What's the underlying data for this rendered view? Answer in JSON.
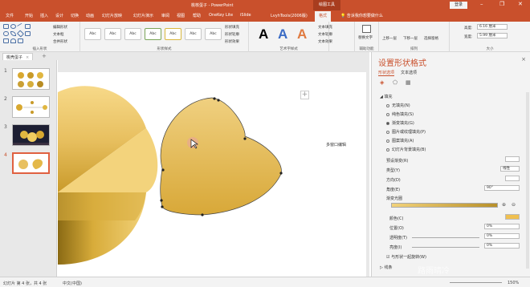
{
  "titlebar": {
    "document": "桃核蛋子 - PowerPoint",
    "context_tab": "绘图工具",
    "login": "登录",
    "minimize": "–",
    "restore": "❐",
    "close": "✕"
  },
  "tabs": [
    "文件",
    "开始",
    "插入",
    "设计",
    "切换",
    "动画",
    "幻灯片放映",
    "幻灯片演示",
    "审阅",
    "视图",
    "帮助",
    "OneKey Lite",
    "iSlide",
    "LvyhTools(2006版)",
    "格式"
  ],
  "tellme": "告诉我你想要做什么",
  "ribbon": {
    "insert_shapes": {
      "label": "插入形状",
      "edit_shape": "编辑形状",
      "text_box": "文本框",
      "merge": "合并形状"
    },
    "shape_styles": {
      "label": "形状样式",
      "style_text": "Abc",
      "fill": "形状填充",
      "outline": "形状轮廓",
      "effects": "形状效果"
    },
    "wordart": {
      "label": "艺术字样式",
      "letter": "A",
      "text_fill": "文本填充",
      "text_outline": "文本轮廓",
      "text_effects": "文本效果"
    },
    "accessibility": {
      "label": "辅助功能",
      "alt_text": "替换文字"
    },
    "arrange": {
      "label": "排列",
      "bring_forward": "上移一层",
      "send_backward": "下移一层",
      "selection_pane": "选择窗格"
    },
    "size": {
      "label": "大小",
      "height_label": "高度:",
      "height": "6.16 厘米",
      "width_label": "宽度:",
      "width": "5.99 厘米"
    }
  },
  "doc_tab": {
    "name": "桃壳蛋子",
    "close": "×",
    "add": "+"
  },
  "slides": [
    {
      "num": "1"
    },
    {
      "num": "2"
    },
    {
      "num": "3"
    },
    {
      "num": "4"
    }
  ],
  "canvas": {
    "multi_window": "多窗口编辑",
    "add_icon": "+"
  },
  "pane": {
    "title": "设置形状格式",
    "close": "×",
    "tab_shape": "形状选项",
    "tab_text": "文本选项",
    "fill_header": "填充",
    "fill_options": [
      "无填充(N)",
      "纯色填充(S)",
      "渐变填充(G)",
      "图片或纹理填充(P)",
      "图案填充(A)",
      "幻灯片背景填充(B)"
    ],
    "selected_fill": 2,
    "preset_label": "预设渐变(R)",
    "type_label": "类型(Y)",
    "type_value": "线性",
    "direction_label": "方向(D)",
    "angle_label": "角度(E)",
    "angle_value": "90°",
    "stops_label": "渐变光圈",
    "color_label": "颜色(C)",
    "position_label": "位置(O)",
    "position_value": "0%",
    "transparency_label": "透明度(T)",
    "transparency_value": "0%",
    "brightness_label": "亮度(I)",
    "brightness_value": "0%",
    "rotate_label": "与形状一起旋转(W)",
    "line_header": "线条"
  },
  "status": {
    "slide_info": "幻灯片 第 4 张，共 4 张",
    "language": "中文(中国)",
    "zoom": "150%"
  },
  "watermark": "路雨晴冷",
  "colors": {
    "accent": "#c9502c",
    "gold": "#e8c060"
  }
}
